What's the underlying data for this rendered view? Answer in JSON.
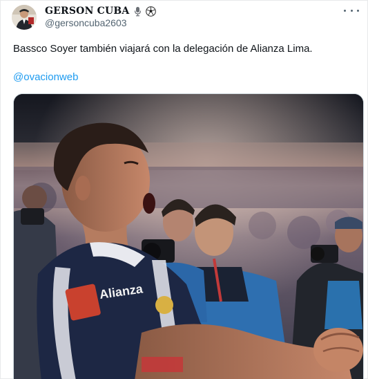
{
  "author": {
    "display_name": "GERSON CUBA",
    "emojis": [
      "microphone-icon",
      "soccer-ball-icon"
    ],
    "handle": "@gersoncuba2603"
  },
  "tweet": {
    "text": "Bassco Soyer también viajará con la delegación de Alianza Lima.",
    "mention": "@ovacionweb"
  },
  "media": {
    "description_icon": "photo",
    "jersey_text": "Alianza"
  },
  "colors": {
    "text": "#0f1419",
    "secondary": "#536471",
    "link": "#1d9bf0",
    "border": "#cfd9de"
  }
}
